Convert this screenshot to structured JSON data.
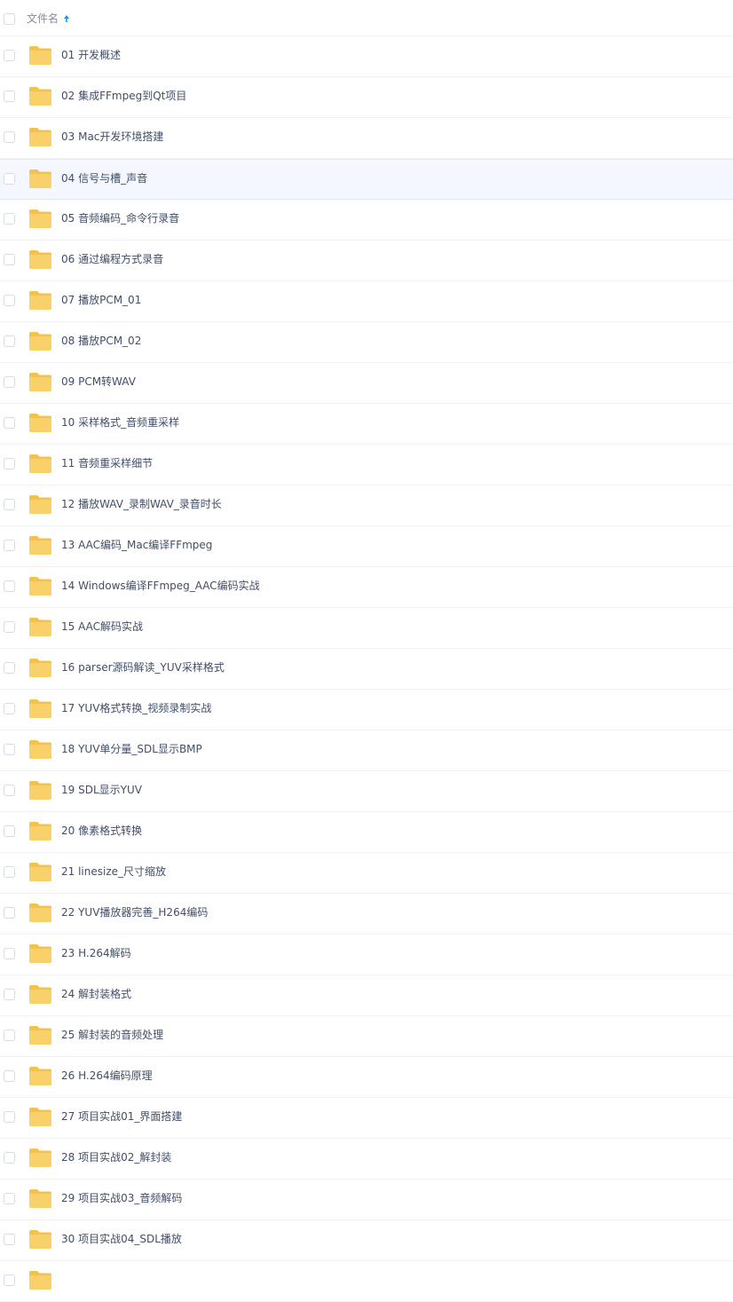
{
  "header": {
    "column_title": "文件名",
    "sort_direction": "ascending"
  },
  "colors": {
    "folder": "#f8d16b",
    "folder_tab": "#f2c14e",
    "accent": "#1e94f0",
    "highlight_row": "#f4f8fe",
    "text": "#424e67"
  },
  "highlighted_row": "04 信号与槽_声音",
  "items": [
    {
      "name": "01 开发概述",
      "icon": "folder-icon"
    },
    {
      "name": "02 集成FFmpeg到Qt项目",
      "icon": "folder-icon"
    },
    {
      "name": "03 Mac开发环境搭建",
      "icon": "folder-icon"
    },
    {
      "name": "04 信号与槽_声音",
      "icon": "folder-icon"
    },
    {
      "name": "05 音频编码_命令行录音",
      "icon": "folder-icon"
    },
    {
      "name": "06 通过编程方式录音",
      "icon": "folder-icon"
    },
    {
      "name": "07 播放PCM_01",
      "icon": "folder-icon"
    },
    {
      "name": "08 播放PCM_02",
      "icon": "folder-icon"
    },
    {
      "name": "09 PCM转WAV",
      "icon": "folder-icon"
    },
    {
      "name": "10 采样格式_音频重采样",
      "icon": "folder-icon"
    },
    {
      "name": "11 音频重采样细节",
      "icon": "folder-icon"
    },
    {
      "name": "12 播放WAV_录制WAV_录音时长",
      "icon": "folder-icon"
    },
    {
      "name": "13 AAC编码_Mac编译FFmpeg",
      "icon": "folder-icon"
    },
    {
      "name": "14 Windows编译FFmpeg_AAC编码实战",
      "icon": "folder-icon"
    },
    {
      "name": "15 AAC解码实战",
      "icon": "folder-icon"
    },
    {
      "name": "16 parser源码解读_YUV采样格式",
      "icon": "folder-icon"
    },
    {
      "name": "17 YUV格式转换_视频录制实战",
      "icon": "folder-icon"
    },
    {
      "name": "18 YUV单分量_SDL显示BMP",
      "icon": "folder-icon"
    },
    {
      "name": "19 SDL显示YUV",
      "icon": "folder-icon"
    },
    {
      "name": "20 像素格式转换",
      "icon": "folder-icon"
    },
    {
      "name": "21 linesize_尺寸缩放",
      "icon": "folder-icon"
    },
    {
      "name": "22 YUV播放器完善_H264编码",
      "icon": "folder-icon"
    },
    {
      "name": "23 H.264解码",
      "icon": "folder-icon"
    },
    {
      "name": "24 解封装格式",
      "icon": "folder-icon"
    },
    {
      "name": "25 解封装的音频处理",
      "icon": "folder-icon"
    },
    {
      "name": "26 H.264编码原理",
      "icon": "folder-icon"
    },
    {
      "name": "27 项目实战01_界面搭建",
      "icon": "folder-icon"
    },
    {
      "name": "28 项目实战02_解封装",
      "icon": "folder-icon"
    },
    {
      "name": "29 项目实战03_音频解码",
      "icon": "folder-icon"
    },
    {
      "name": "30 项目实战04_SDL播放",
      "icon": "folder-icon"
    },
    {
      "name": "",
      "icon": "folder-icon"
    }
  ]
}
